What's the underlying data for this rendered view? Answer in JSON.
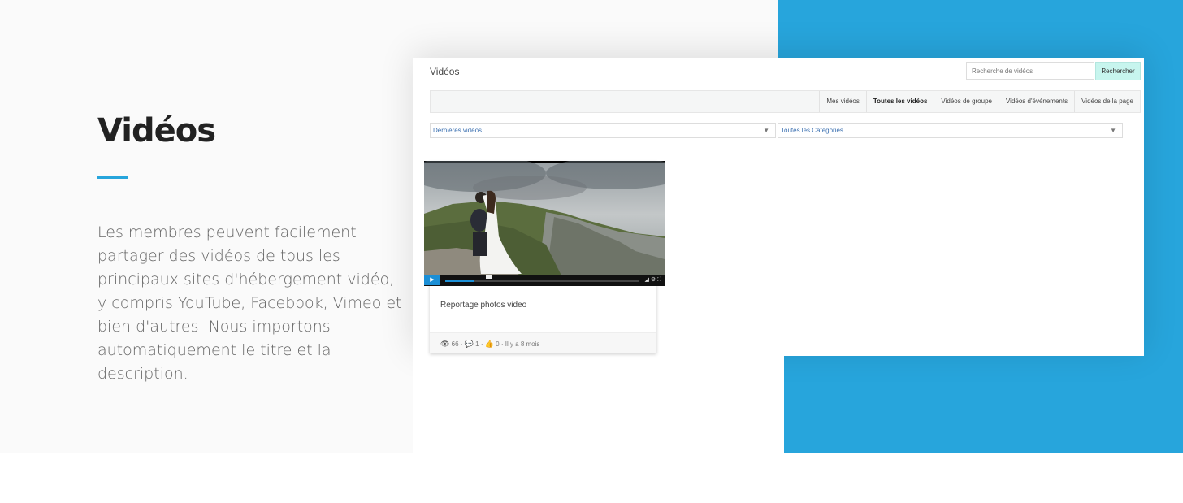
{
  "hero": {
    "title": "Vidéos",
    "description": "Les membres peuvent facilement partager des vidéos de tous les principaux sites d'hébergement vidéo, y compris YouTube, Facebook, Vimeo et bien d'autres. Nous importons automatiquement le titre et la description."
  },
  "colors": {
    "accent": "#27a5dc",
    "search_button": "#c7f5ee",
    "link": "#3a6fb0"
  },
  "app": {
    "title": "Vidéos",
    "search": {
      "placeholder": "Recherche de vidéos",
      "button_label": "Rechercher"
    },
    "tabs": [
      {
        "label": "Mes vidéos",
        "active": false
      },
      {
        "label": "Toutes les vidéos",
        "active": true
      },
      {
        "label": "Vidéos de groupe",
        "active": false
      },
      {
        "label": "Vidéos d'événements",
        "active": false
      },
      {
        "label": "Vidéos de la page",
        "active": false
      }
    ],
    "filters": {
      "sort": "Dernières vidéos",
      "category": "Toutes les Catégories"
    },
    "video": {
      "title": "Reportage photos video",
      "views": "66",
      "comments": "1",
      "likes": "0",
      "age": "Il y a 8 mois",
      "progress": 0.15
    }
  }
}
